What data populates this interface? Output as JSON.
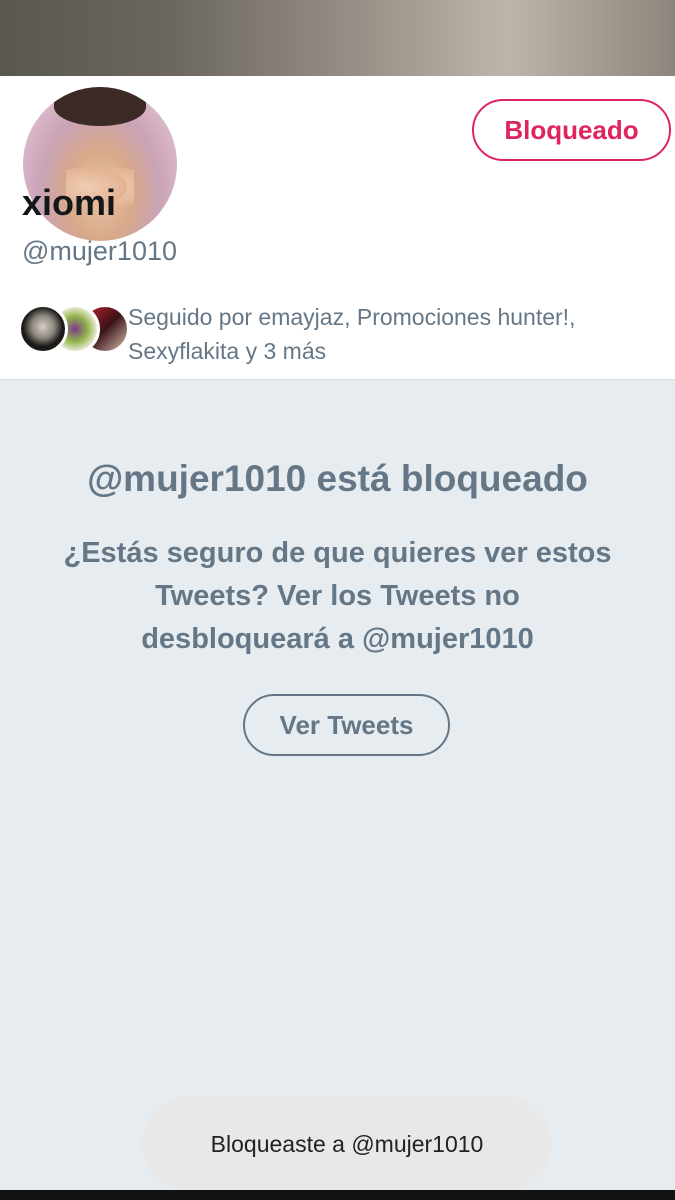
{
  "profile": {
    "name": "xiomi",
    "handle": "@mujer1010",
    "blocked_label": "Bloqueado",
    "followed_by_text": "Seguido por emayjaz, Promociones hunter!, Sexyflakita y 3 más"
  },
  "blocked_notice": {
    "title": "@mujer1010 está bloqueado",
    "message": "¿Estás seguro de que quieres ver estos Tweets? Ver los Tweets no desbloqueará a @mujer1010",
    "view_tweets_label": "Ver Tweets"
  },
  "toast": {
    "text": "Bloqueaste a @mujer1010"
  },
  "colors": {
    "accent_red": "#e0245e",
    "muted_gray": "#657786",
    "background": "#e6ecf0"
  }
}
